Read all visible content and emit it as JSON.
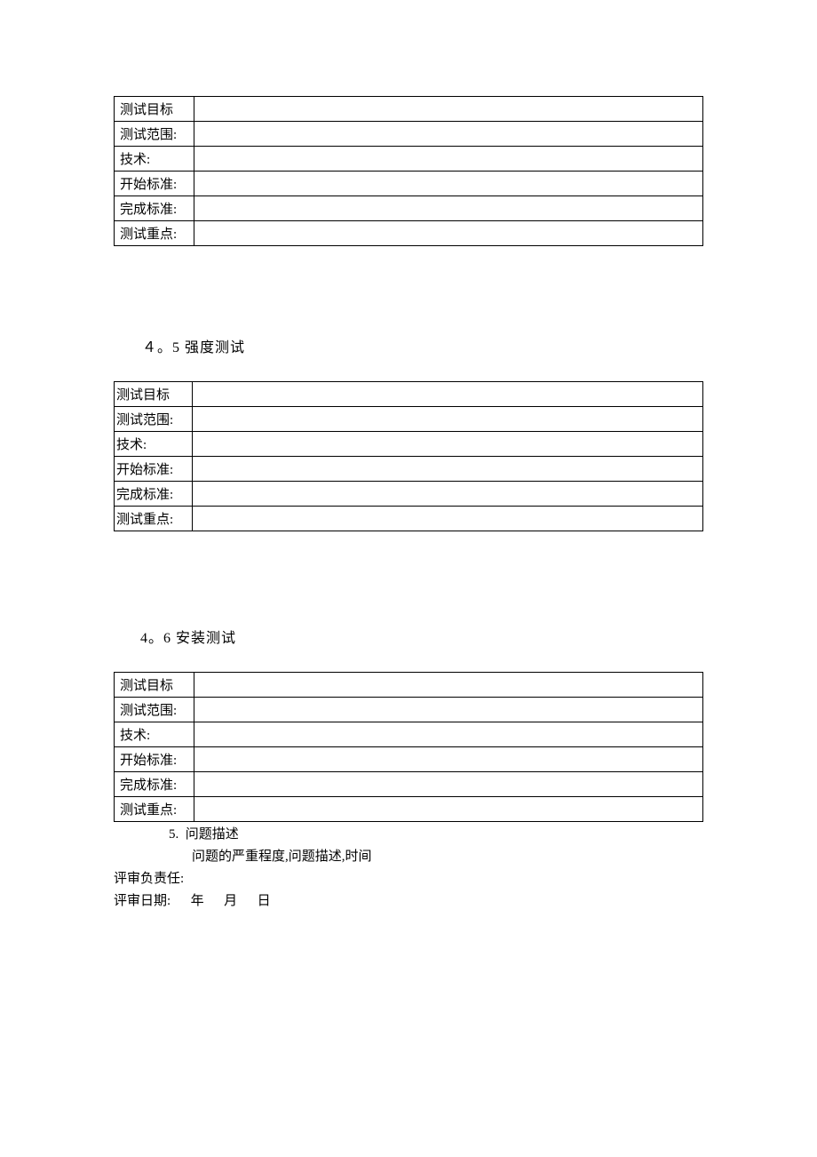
{
  "tables": {
    "common_rows": [
      "测试目标",
      "测试范围:",
      "技术:",
      "开始标准:",
      "完成标准:",
      "测试重点:"
    ]
  },
  "headings": {
    "h45": "４。5 强度测试",
    "h46": "4。6 安装测试"
  },
  "section5": {
    "title": "5.  问题描述",
    "desc": "问题的严重程度,问题描述,时间"
  },
  "review": {
    "responsible": "评审负责任:",
    "date": "评审日期:      年      月      日"
  }
}
